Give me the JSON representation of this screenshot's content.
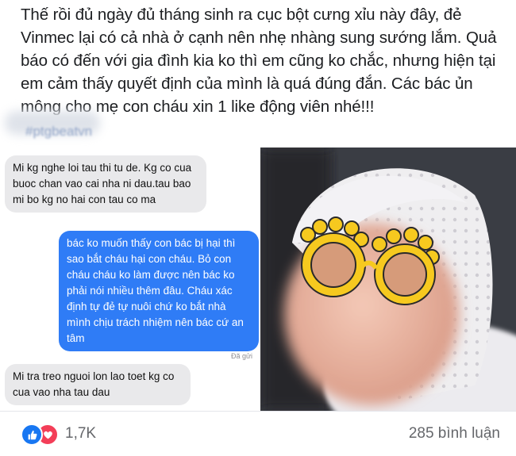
{
  "post": {
    "text": "Thế rồi đủ ngày đủ tháng sinh ra cục bột cưng xỉu này đây, đẻ Vinmec lại có cả nhà ở cạnh nên nhẹ nhàng sung sướng lắm. Quả báo có đến với gia đình kia ko thì em cũng ko chắc, nhưng hiện tại em cảm thấy quyết định của mình là quá đúng đắn. Các bác ủn mông cho mẹ con cháu xin 1 like động viên nhé!!!",
    "hashtag": "#ptgbeatvn"
  },
  "chat": {
    "messages": [
      {
        "side": "in",
        "text": "Mi kg nghe loi tau thi tu de. Kg co cua buoc chan vao cai nha ni dau.tau bao mi bo kg no hai con tau co ma"
      },
      {
        "side": "out",
        "text": "bác ko muốn thấy con bác bị hại thì sao bắt cháu hại con cháu. Bỏ con cháu cháu ko làm được nên bác ko phải nói nhiều thêm đâu. Cháu xác định tự đẻ tự nuôi chứ ko bắt nhà mình chịu trách nhiệm nên bác cứ an tâm"
      },
      {
        "side": "in",
        "text": "Mi tra treo nguoi lon lao toet kg co cua vao nha tau dau"
      }
    ],
    "delivered_label": "Đã gửi"
  },
  "reactions": {
    "icons": [
      "like-icon",
      "love-icon"
    ],
    "count": "1,7K",
    "comments": "285 bình luận"
  },
  "colors": {
    "outgoing_bubble": "#2f7cf6",
    "incoming_bubble": "#e9e9eb",
    "like": "#1877f2",
    "love": "#f33e58"
  }
}
